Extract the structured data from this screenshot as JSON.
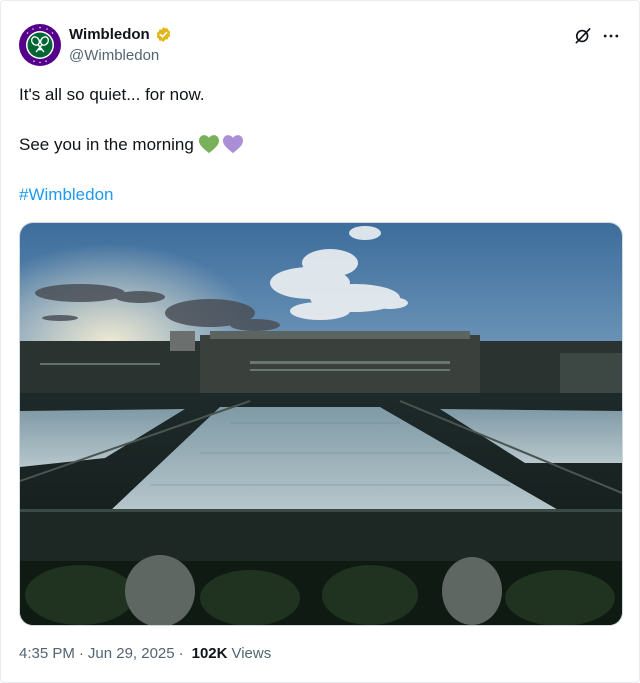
{
  "account": {
    "display_name": "Wimbledon",
    "handle": "@Wimbledon",
    "verified": "gold-verified-badge-icon",
    "avatar_ring_text_top": "THE CHAMPIONSHIPS",
    "avatar_ring_text_bottom": "WIMBLEDON"
  },
  "tweet": {
    "line1": "It's all so quiet... for now.",
    "line2": "See you in the morning",
    "emojis": [
      "green-heart-icon",
      "purple-heart-icon"
    ],
    "hashtag": "#Wimbledon"
  },
  "meta": {
    "time": "4:35 PM",
    "date": "Jun 29, 2025",
    "separator": "·",
    "views_count": "102K",
    "views_label": "Views"
  },
  "colors": {
    "link": "#1d9bf0",
    "wimbledon_purple": "#54008b",
    "wimbledon_green": "#006633",
    "verified_gold": "#e2b719",
    "green_heart": "#78b159",
    "purple_heart": "#aa8ed6"
  },
  "actions": {
    "grok_icon": "grok-icon",
    "more_icon": "more-options-icon"
  }
}
